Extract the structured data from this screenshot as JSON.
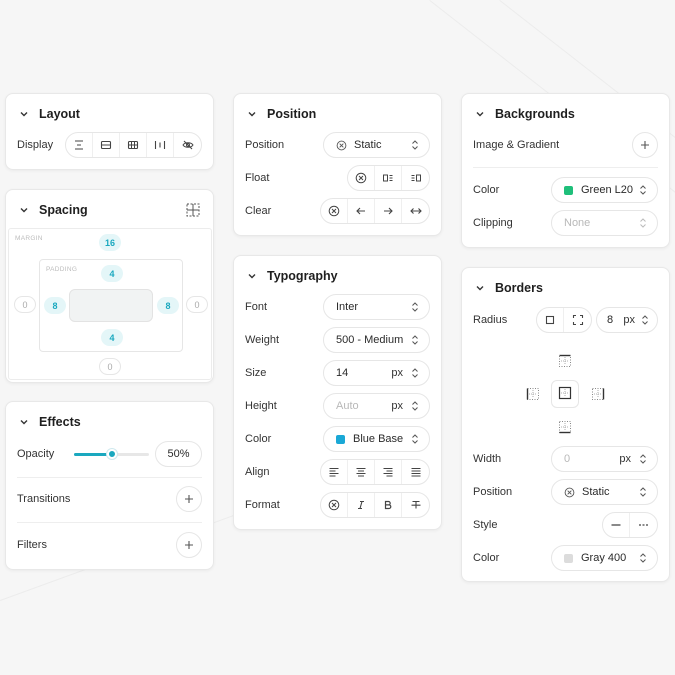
{
  "layout": {
    "title": "Layout",
    "display_label": "Display"
  },
  "position_panel": {
    "title": "Position",
    "position_label": "Position",
    "position_value": "Static",
    "float_label": "Float",
    "clear_label": "Clear"
  },
  "backgrounds": {
    "title": "Backgrounds",
    "image_label": "Image & Gradient",
    "color_label": "Color",
    "color_value": "Green L20",
    "color_hex": "#1fbf7a",
    "clipping_label": "Clipping",
    "clipping_placeholder": "None"
  },
  "spacing": {
    "title": "Spacing",
    "margin_label": "MARGIN",
    "padding_label": "PADDING",
    "margin_top": "16",
    "margin_left": "0",
    "margin_right": "0",
    "margin_bottom": "0",
    "padding_top": "4",
    "padding_left": "8",
    "padding_right": "8",
    "padding_bottom": "4"
  },
  "typography": {
    "title": "Typography",
    "font_label": "Font",
    "font_value": "Inter",
    "weight_label": "Weight",
    "weight_value": "500 - Medium",
    "size_label": "Size",
    "size_value": "14",
    "size_unit": "px",
    "height_label": "Height",
    "height_placeholder": "Auto",
    "height_unit": "px",
    "color_label": "Color",
    "color_value": "Blue Base",
    "color_hex": "#1aa8d6",
    "align_label": "Align",
    "format_label": "Format"
  },
  "borders": {
    "title": "Borders",
    "radius_label": "Radius",
    "radius_value": "8",
    "radius_unit": "px",
    "width_label": "Width",
    "width_placeholder": "0",
    "width_unit": "px",
    "position_label": "Position",
    "position_value": "Static",
    "style_label": "Style",
    "color_label": "Color",
    "color_value": "Gray 400",
    "color_hex": "#dcdcdc"
  },
  "effects": {
    "title": "Effects",
    "opacity_label": "Opacity",
    "opacity_value": "50%",
    "opacity_fraction": 0.5,
    "transitions_label": "Transitions",
    "filters_label": "Filters"
  },
  "colors": {
    "accent": "#1aa8bf"
  }
}
